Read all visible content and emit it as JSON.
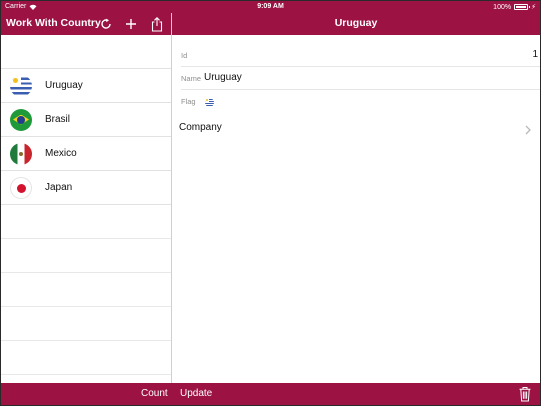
{
  "status_bar": {
    "carrier": "Carrier",
    "time": "9:09 AM",
    "battery": "100%"
  },
  "left_nav": {
    "title": "Work With Country",
    "icons": [
      "refresh-icon",
      "add-icon",
      "share-icon"
    ]
  },
  "countries": [
    {
      "name": "Uruguay",
      "flag": "uruguay-flag-icon"
    },
    {
      "name": "Brasil",
      "flag": "brazil-flag-icon"
    },
    {
      "name": "Mexico",
      "flag": "mexico-flag-icon"
    },
    {
      "name": "Japan",
      "flag": "japan-flag-icon"
    }
  ],
  "detail": {
    "header_title": "Uruguay",
    "fields": {
      "id_label": "Id",
      "id_value": "1",
      "name_label": "Name",
      "name_value": "Uruguay",
      "flag_label": "Flag"
    },
    "company_label": "Company"
  },
  "bottom_bar": {
    "count_label": "Count",
    "update_label": "Update",
    "icons": [
      "trash-icon"
    ]
  },
  "colors": {
    "brand": "#9b1243",
    "background": "#ffffff",
    "separator": "#e2e2e2",
    "label_gray": "#8f8f8f"
  }
}
